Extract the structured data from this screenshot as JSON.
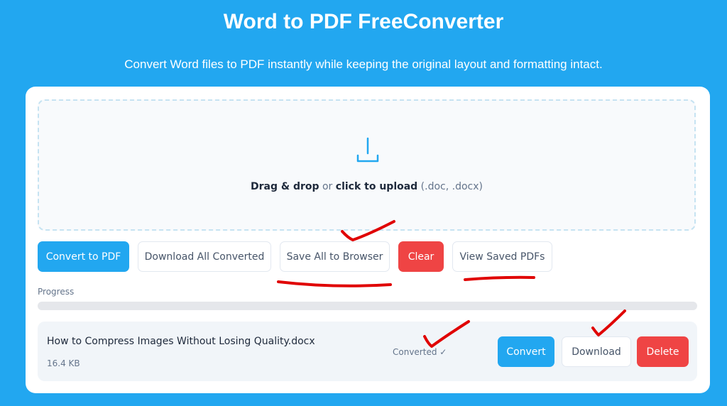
{
  "header": {
    "title": "Word to PDF FreeConverter",
    "subtitle": "Convert Word files to PDF instantly while keeping the original layout and formatting intact."
  },
  "dropzone": {
    "icon": "download-tray-icon",
    "strong1": "Drag & drop",
    "mid": " or ",
    "strong2": "click to upload",
    "suffix": " (.doc, .docx)"
  },
  "toolbar": {
    "convert_label": "Convert to PDF",
    "download_all_label": "Download All Converted",
    "save_all_label": "Save All to Browser",
    "clear_label": "Clear",
    "view_saved_label": "View Saved PDFs"
  },
  "progress": {
    "label": "Progress",
    "value": 0
  },
  "files": [
    {
      "name": "How to Compress Images Without Losing Quality.docx",
      "size": "16.4 KB",
      "status": "Converted ✓",
      "convert_label": "Convert",
      "download_label": "Download",
      "delete_label": "Delete"
    }
  ],
  "colors": {
    "background": "#22a7f0",
    "accent": "#22a7f0",
    "danger": "#ef4444",
    "annotation": "#e00000"
  }
}
